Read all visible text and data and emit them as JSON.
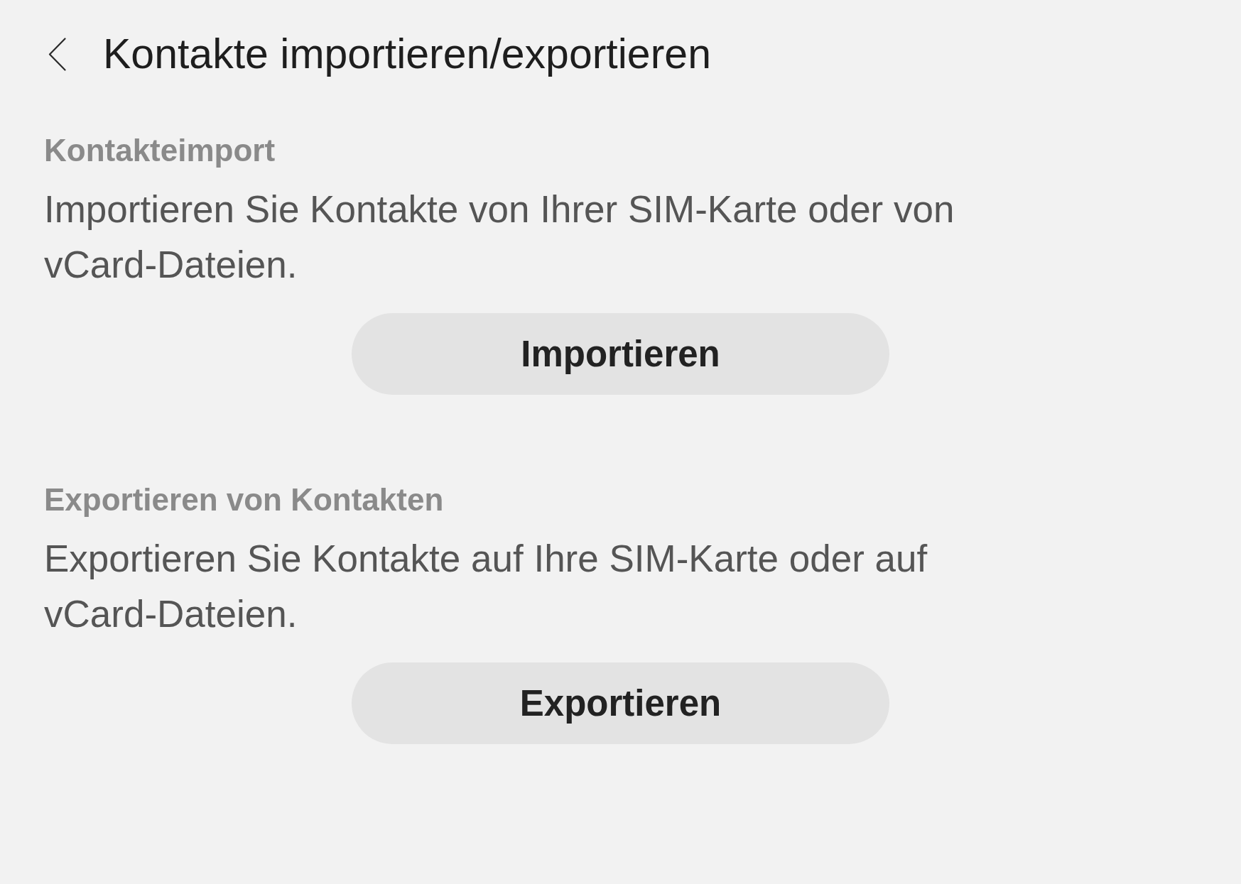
{
  "header": {
    "title": "Kontakte importieren/exportieren"
  },
  "sections": [
    {
      "heading": "Kontakteimport",
      "description": "Importieren Sie Kontakte von Ihrer SIM-Karte oder von vCard-Dateien.",
      "button": "Importieren"
    },
    {
      "heading": "Exportieren von Kontakten",
      "description": "Exportieren Sie Kontakte auf Ihre SIM-Karte oder auf vCard-Dateien.",
      "button": "Exportieren"
    }
  ]
}
